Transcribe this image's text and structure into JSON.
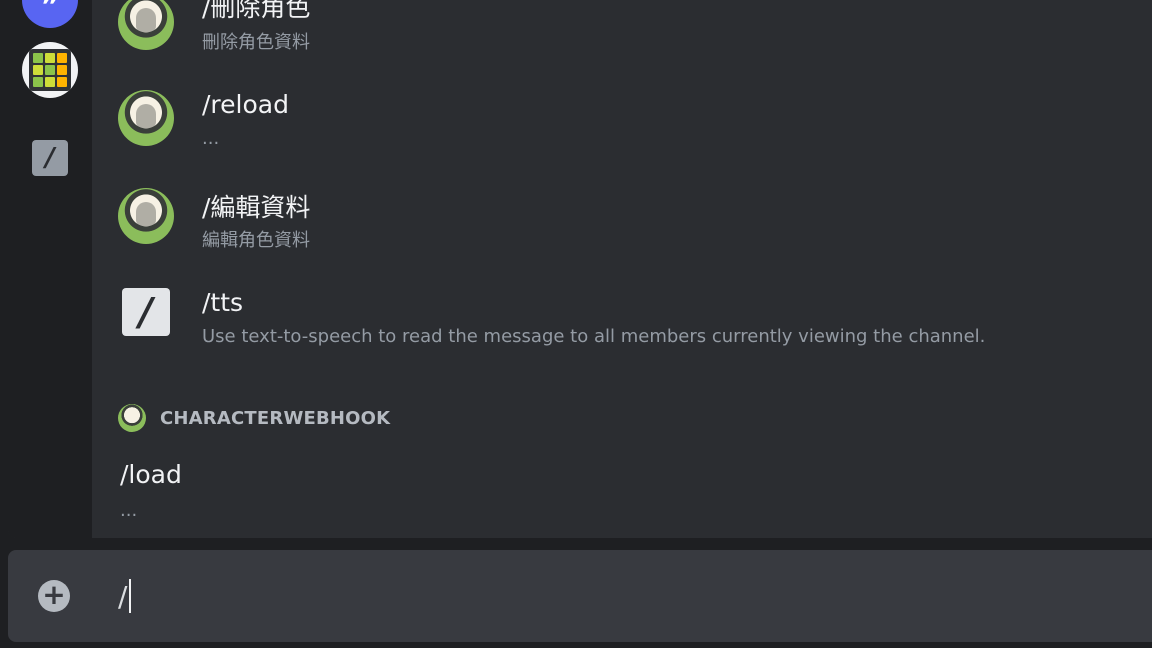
{
  "commands": [
    {
      "name": "/刪除角色",
      "desc": "刪除角色資料",
      "icon": "character-avatar"
    },
    {
      "name": "/reload",
      "desc": "...",
      "icon": "character-avatar"
    },
    {
      "name": "/編輯資料",
      "desc": "編輯角色資料",
      "icon": "character-avatar"
    },
    {
      "name": "/tts",
      "desc": "Use text-to-speech to read the message to all members currently viewing the channel.",
      "icon": "slash-icon"
    }
  ],
  "section": {
    "label": "CHARACTERWEBHOOK",
    "command": {
      "name": "/load",
      "desc": "..."
    }
  },
  "sidebar": {
    "icons": [
      "quote-icon",
      "grid-app-icon",
      "slash-icon"
    ]
  },
  "composer": {
    "value": "/",
    "add_icon": "plus-circle-icon"
  },
  "colors": {
    "background": "#1e1f22",
    "popup": "#2b2d31",
    "composer": "#383a40",
    "accent": "#5865f2"
  }
}
